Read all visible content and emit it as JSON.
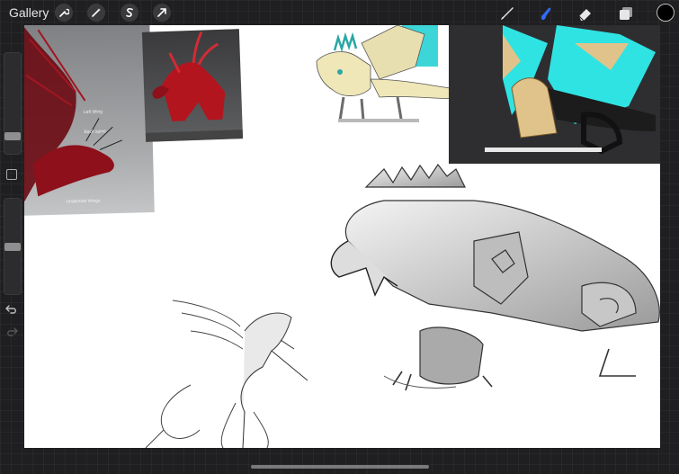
{
  "toolbar": {
    "gallery_label": "Gallery",
    "left_tools": [
      "wrench-icon",
      "magic-wand-icon",
      "selection-s-icon",
      "transform-arrow-icon"
    ],
    "right_tools": [
      "brush-icon",
      "smudge-icon",
      "eraser-icon",
      "layers-icon"
    ],
    "active_tool": "smudge-icon",
    "active_color": "#000000",
    "accent_color": "#2f6bff"
  },
  "sidebar": {
    "brush_size_level": 0.15,
    "opacity_level": 0.5
  },
  "canvas": {
    "background": "#ffffff"
  },
  "references": {
    "red_dragon_label_1": "Left Wing",
    "red_dragon_label_2": "Back spine",
    "red_dragon_label_3": "Underside Wings"
  }
}
